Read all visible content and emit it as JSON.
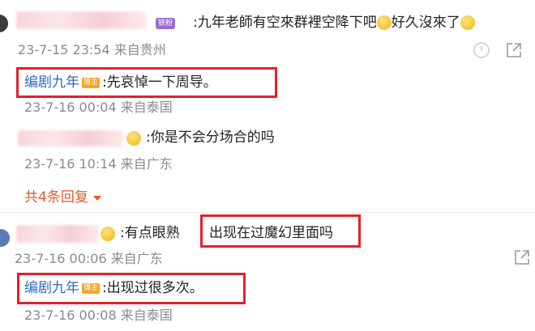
{
  "comments": [
    {
      "badge": "铁粉",
      "text_a": ":九年老師有空來群裡空降下吧",
      "text_b": "好久沒來了",
      "meta": "23-7-15 23:54 来自贵州"
    },
    {
      "author": "编剧九年",
      "badge": "博主",
      "text": ":先哀悼一下周导。",
      "meta": "23-7-16 00:04 来自泰国"
    },
    {
      "text": ":你是不会分场合的吗",
      "meta": "23-7-16 10:14 来自广东"
    },
    {
      "more_replies": "共4条回复"
    },
    {
      "text_a": ":有点眼熟",
      "text_b": "出现在过魔幻里面吗",
      "meta": "23-7-16 00:06 来自广东"
    },
    {
      "author": "编剧九年",
      "badge": "博主",
      "text": ":出现过很多次。",
      "meta": "23-7-16 00:08 来自泰国"
    }
  ],
  "colors": {
    "highlight_box": "#e2222a",
    "author_name": "#2b6cc4",
    "more_link": "#e25a2a",
    "meta_gray": "#8a8a8a"
  },
  "icons": [
    "emoji-laugh-cry-icon",
    "emoji-grimace-icon",
    "share-icon",
    "dislike-icon",
    "chevron-down-icon"
  ]
}
